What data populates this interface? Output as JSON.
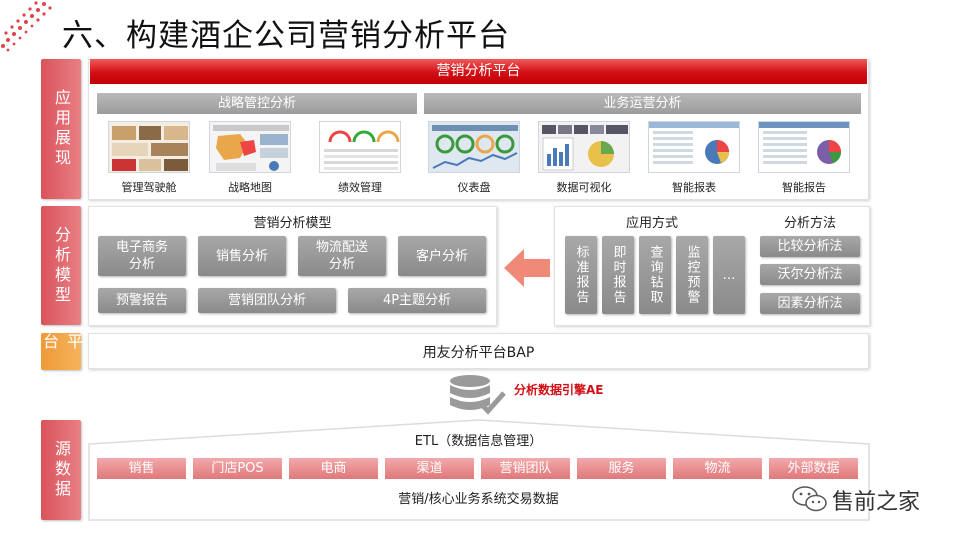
{
  "title": "六、构建酒企公司营销分析平台",
  "side_labels": {
    "app": "应用展现",
    "analysis": "分析模型",
    "platform": "平台",
    "source": "源数据"
  },
  "platform_bar": "营销分析平台",
  "strategy_head": "战略管控分析",
  "ops_head": "业务运营分析",
  "thumbnails": [
    "管理驾驶舱",
    "战略地图",
    "绩效管理",
    "仪表盘",
    "数据可视化",
    "智能报表",
    "智能报告"
  ],
  "model": {
    "title": "营销分析模型",
    "row1": [
      "电子商务\n分析",
      "销售分析",
      "物流配送\n分析",
      "客户分析"
    ],
    "row2": [
      "预警报告",
      "营销团队分析",
      "4P主题分析"
    ]
  },
  "apply": {
    "title": "应用方式",
    "items": [
      "标准报告",
      "即时报告",
      "查询钻取",
      "监控预警",
      "…"
    ]
  },
  "method": {
    "title": "分析方法",
    "items": [
      "比较分析法",
      "沃尔分析法",
      "因素分析法"
    ]
  },
  "bap": "用友分析平台BAP",
  "engine": "分析数据引擎AE",
  "etl": "ETL（数据信息管理）",
  "sources": [
    "销售",
    "门店POS",
    "电商",
    "渠道",
    "营销团队",
    "服务",
    "物流",
    "外部数据"
  ],
  "core": "营销/核心业务系统交易数据",
  "watermark": "售前之家",
  "colors": {
    "accent_red": "#d10f14",
    "side_red": "#e06066",
    "side_orange": "#f0a040",
    "arrow": "#ef8a78"
  }
}
